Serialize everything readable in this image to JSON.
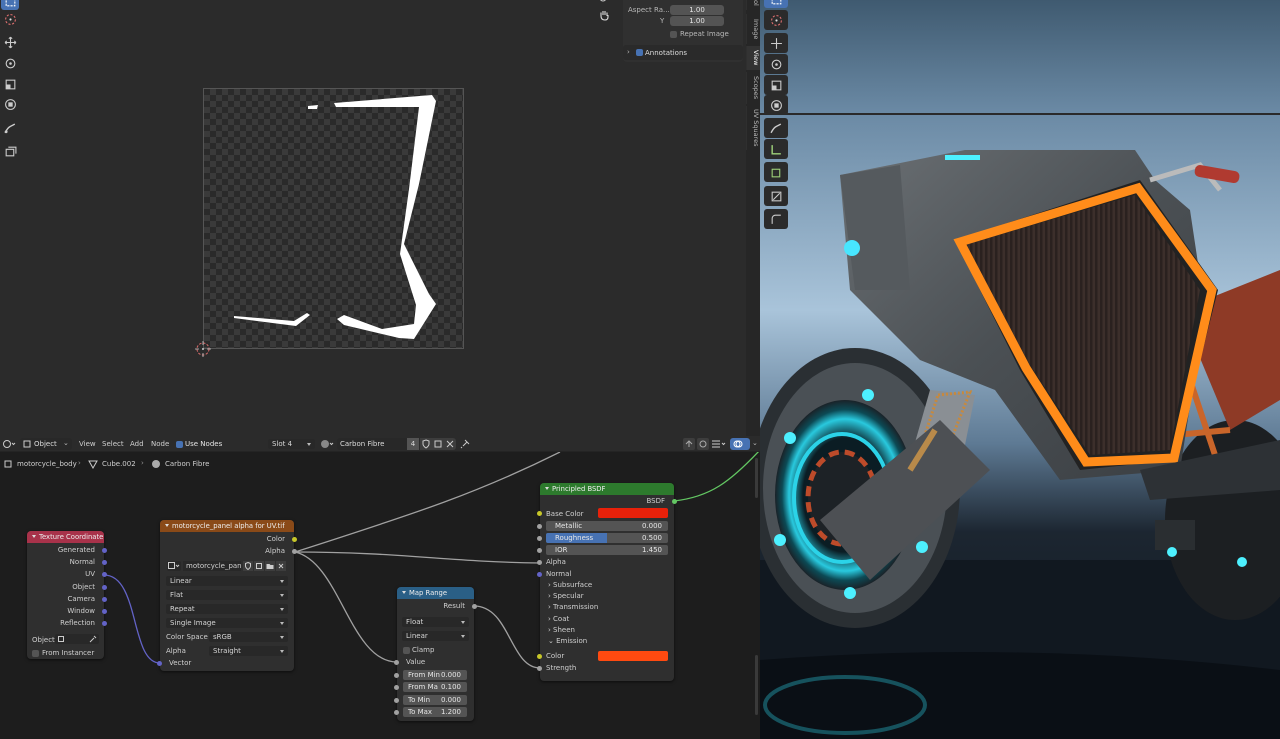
{
  "uv_editor": {
    "n_panel": {
      "aspect_label": "Aspect Ra...",
      "aspect_x": "1.00",
      "y_label": "Y",
      "aspect_y": "1.00",
      "repeat_image": "Repeat Image",
      "annotations": "Annotations"
    },
    "tabs": [
      "ol",
      "Image",
      "View",
      "Scopes",
      "UV Squares"
    ]
  },
  "node_editor": {
    "header": {
      "mode": "Object",
      "menus": [
        "View",
        "Select",
        "Add",
        "Node"
      ],
      "use_nodes": "Use Nodes",
      "slot": "Slot 4",
      "material": "Carbon Fibre",
      "user_count": "4"
    },
    "breadcrumb": {
      "object": "motorcycle_body",
      "mesh": "Cube.002",
      "material": "Carbon Fibre"
    },
    "texture_coordinate": {
      "title": "Texture Coordinate",
      "outputs": [
        "Generated",
        "Normal",
        "UV",
        "Object",
        "Camera",
        "Window",
        "Reflection"
      ],
      "object_label": "Object:",
      "from_instancer": "From Instancer"
    },
    "image_texture": {
      "title": "motorcycle_panel alpha for UV.tif",
      "outputs": [
        "Color",
        "Alpha"
      ],
      "image_name": "motorcycle_pan...",
      "interpolation": "Linear",
      "projection": "Flat",
      "extension": "Repeat",
      "source": "Single Image",
      "color_space_label": "Color Space",
      "color_space": "sRGB",
      "alpha_label": "Alpha",
      "alpha_mode": "Straight",
      "input": "Vector"
    },
    "map_range": {
      "title": "Map Range",
      "output": "Result",
      "data_type": "Float",
      "interpolation": "Linear",
      "clamp": "Clamp",
      "value_label": "Value",
      "fields": [
        {
          "label": "From Min",
          "value": "0.000"
        },
        {
          "label": "From Ma",
          "value": "0.100"
        },
        {
          "label": "To Min",
          "value": "0.000"
        },
        {
          "label": "To Max",
          "value": "1.200"
        }
      ]
    },
    "principled": {
      "title": "Principled BSDF",
      "output": "BSDF",
      "base_color_label": "Base Color",
      "base_color": "#e8210a",
      "metallic_label": "Metallic",
      "metallic": "0.000",
      "roughness_label": "Roughness",
      "roughness": "0.500",
      "roughness_fill": 0.5,
      "ior_label": "IOR",
      "ior": "1.450",
      "alpha_label": "Alpha",
      "normal_label": "Normal",
      "panels": [
        "Subsurface",
        "Specular",
        "Transmission",
        "Coat",
        "Sheen",
        "Emission"
      ],
      "emission_color_label": "Color",
      "emission_color": "#ff4a10",
      "strength_label": "Strength"
    }
  },
  "colors": {
    "texcoord_header": "#a8324a",
    "image_header": "#8a4a18",
    "maprange_header": "#2a5f86",
    "principled_header": "#2d7a2d",
    "socket_yellow": "#c7c729",
    "socket_gray": "#a1a1a1",
    "socket_purple": "#6363c7",
    "socket_green": "#63c763",
    "accent_blue": "#4772b3"
  }
}
